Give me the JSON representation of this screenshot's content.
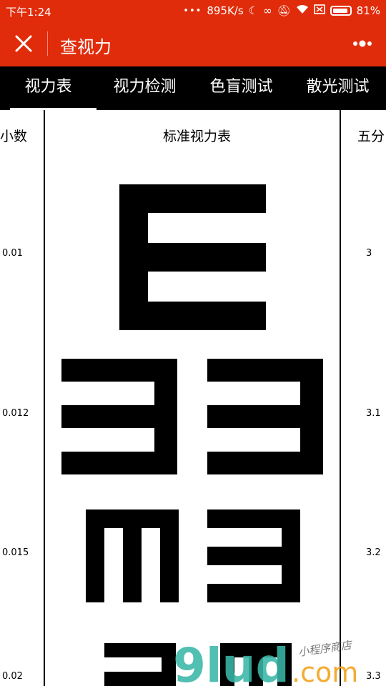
{
  "status": {
    "time": "下午1:24",
    "network_speed": "895K/s",
    "battery": "81%"
  },
  "header": {
    "title": "查视力"
  },
  "tabs": [
    {
      "label": "视力表",
      "active": true
    },
    {
      "label": "视力检测",
      "active": false
    },
    {
      "label": "色盲测试",
      "active": false
    },
    {
      "label": "散光测试",
      "active": false
    }
  ],
  "chart": {
    "title": "标准视力表",
    "left_header": "小数",
    "right_header": "五分",
    "rows": [
      {
        "decimal": "0.01",
        "five_point": "3"
      },
      {
        "decimal": "0.012",
        "five_point": "3.1"
      },
      {
        "decimal": "0.015",
        "five_point": "3.2"
      },
      {
        "decimal": "0.02",
        "five_point": "3.3"
      }
    ]
  },
  "watermark": {
    "text": "9lud",
    "domain": ".com",
    "subtitle": "小程序商店"
  },
  "colors": {
    "accent": "#e12c0c",
    "tabbar": "#000000"
  }
}
